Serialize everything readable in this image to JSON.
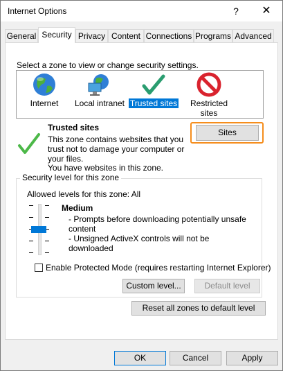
{
  "window": {
    "title": "Internet Options",
    "help": "?",
    "close": "✕"
  },
  "tabs": [
    "General",
    "Security",
    "Privacy",
    "Content",
    "Connections",
    "Programs",
    "Advanced"
  ],
  "active_tab": "Security",
  "zones": {
    "prompt": "Select a zone to view or change security settings.",
    "items": [
      "Internet",
      "Local intranet",
      "Trusted sites",
      "Restricted sites"
    ],
    "selected": "Trusted sites"
  },
  "zone_info": {
    "title": "Trusted sites",
    "description": "This zone contains websites that you trust not to damage your computer or your files.",
    "note": "You have websites in this zone.",
    "sites_button": "Sites"
  },
  "security_level": {
    "group_label": "Security level for this zone",
    "allowed_levels": "Allowed levels for this zone: All",
    "level_name": "Medium",
    "bullets": [
      "- Prompts before downloading potentially unsafe content",
      "- Unsigned ActiveX controls will not be downloaded"
    ],
    "slider_positions": 5,
    "slider_level_index": 2
  },
  "protected_mode": {
    "label": "Enable Protected Mode (requires restarting Internet Explorer)",
    "checked": false
  },
  "buttons": {
    "custom_level": "Custom level...",
    "default_level": "Default level",
    "reset_all": "Reset all zones to default level",
    "ok": "OK",
    "cancel": "Cancel",
    "apply": "Apply"
  },
  "colors": {
    "accent": "#0078d7",
    "focus_outline": "#f58d1c",
    "check_green": "#2a9d48",
    "restricted_red": "#d9232e"
  }
}
